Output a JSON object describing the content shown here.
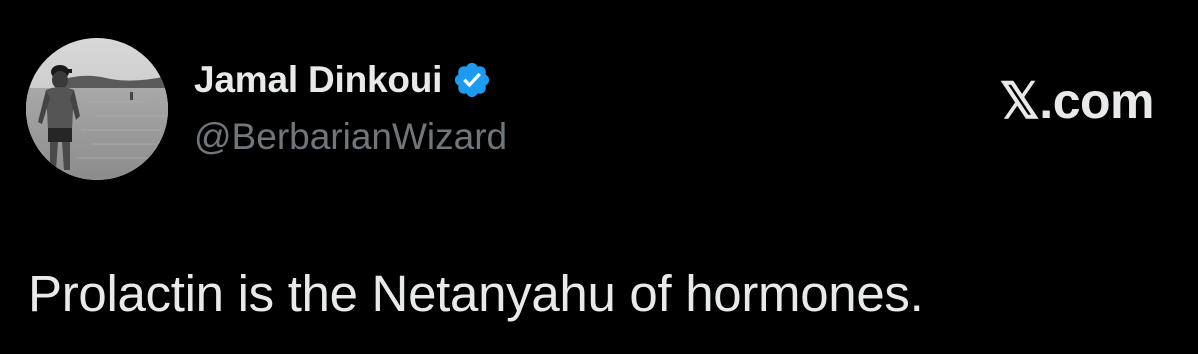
{
  "post": {
    "author": {
      "display_name": "Jamal Dinkoui",
      "handle": "@BerbarianWizard",
      "verified_badge_icon": "verified-badge-icon",
      "verified_color": "#1d9bf0"
    },
    "brand": "𝕏.com",
    "text": "Prolactin is the Netanyahu of hormones."
  },
  "colors": {
    "background": "#000000",
    "primary_text": "#e7e9ea",
    "secondary_text": "#71767b"
  }
}
